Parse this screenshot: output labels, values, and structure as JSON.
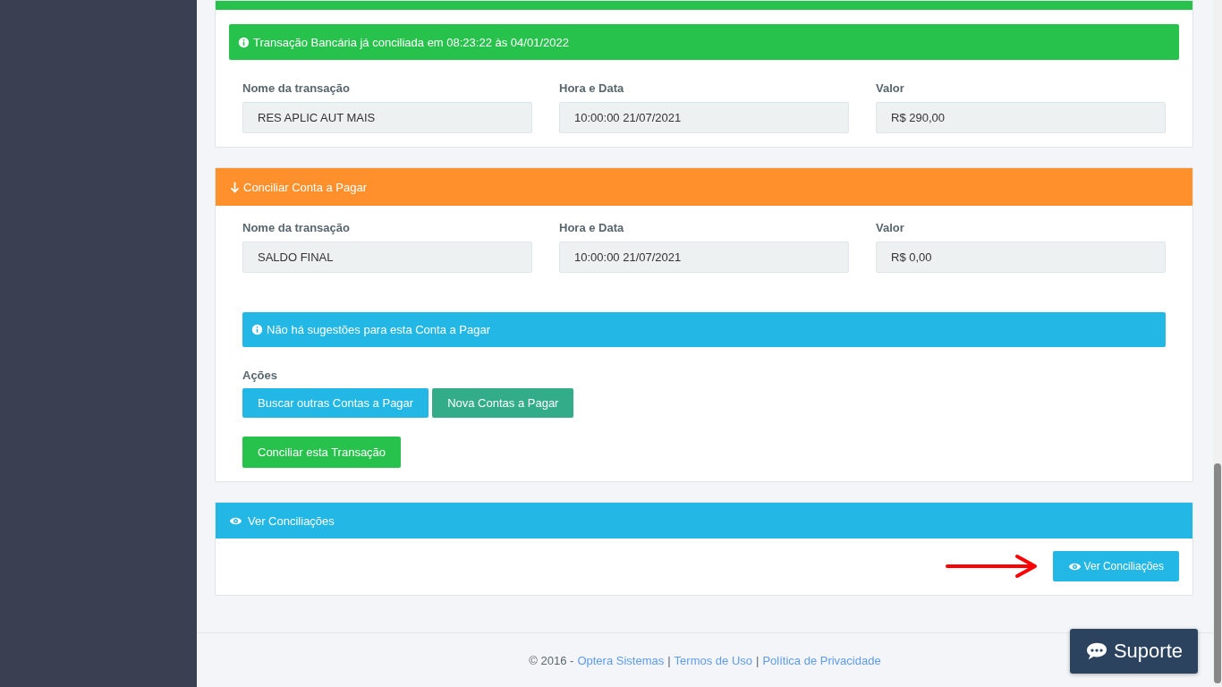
{
  "reconciled_panel": {
    "alert": "Transação Bancária já conciliada em 08:23:22 às 04/01/2022",
    "fields": [
      {
        "label": "Nome da transação",
        "value": "RES APLIC AUT MAIS"
      },
      {
        "label": "Hora e Data",
        "value": "10:00:00 21/07/2021"
      },
      {
        "label": "Valor",
        "value": "R$ 290,00"
      }
    ]
  },
  "payable_panel": {
    "title": "Conciliar Conta a Pagar",
    "fields": [
      {
        "label": "Nome da transação",
        "value": "SALDO FINAL"
      },
      {
        "label": "Hora e Data",
        "value": "10:00:00 21/07/2021"
      },
      {
        "label": "Valor",
        "value": "R$ 0,00"
      }
    ],
    "alert": "Não há sugestões para esta Conta a Pagar",
    "actions_label": "Ações",
    "action_buttons": [
      {
        "label": "Buscar outras Contas a Pagar",
        "kind": "info"
      },
      {
        "label": "Nova Contas a Pagar",
        "kind": "teal"
      }
    ],
    "submit_button": "Conciliar esta Transação"
  },
  "view_panel": {
    "title": "Ver Conciliações",
    "button": "Ver Conciliações"
  },
  "footer": {
    "copyright": "© 2016 -",
    "separator": "|",
    "links": [
      "Optera Sistemas",
      "Termos de Uso",
      "Política de Privacidade"
    ]
  },
  "support_button": "Suporte"
}
